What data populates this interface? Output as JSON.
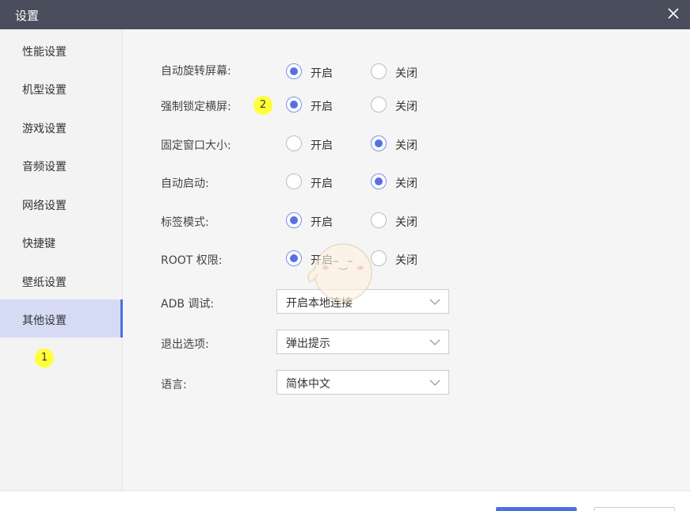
{
  "window": {
    "title": "设置",
    "close_icon": "close-icon"
  },
  "sidebar": {
    "items": [
      {
        "label": "性能设置",
        "active": false
      },
      {
        "label": "机型设置",
        "active": false
      },
      {
        "label": "游戏设置",
        "active": false
      },
      {
        "label": "音频设置",
        "active": false
      },
      {
        "label": "网络设置",
        "active": false
      },
      {
        "label": "快捷键",
        "active": false
      },
      {
        "label": "壁纸设置",
        "active": false
      },
      {
        "label": "其他设置",
        "active": true
      }
    ],
    "badge": "1"
  },
  "settings": {
    "badge": "2",
    "radio_rows": [
      {
        "label": "自动旋转屏幕:",
        "on_label": "开启",
        "off_label": "关闭",
        "selected": "on"
      },
      {
        "label": "强制锁定横屏:",
        "on_label": "开启",
        "off_label": "关闭",
        "selected": "on"
      },
      {
        "label": "固定窗口大小:",
        "on_label": "开启",
        "off_label": "关闭",
        "selected": "off"
      },
      {
        "label": "自动启动:",
        "on_label": "开启",
        "off_label": "关闭",
        "selected": "off"
      },
      {
        "label": "标签模式:",
        "on_label": "开启",
        "off_label": "关闭",
        "selected": "on"
      },
      {
        "label": "ROOT 权限:",
        "on_label": "开启",
        "off_label": "关闭",
        "selected": "on"
      }
    ],
    "selects": [
      {
        "label": "ADB 调试:",
        "value": "开启本地连接"
      },
      {
        "label": "退出选项:",
        "value": "弹出提示"
      },
      {
        "label": "语言:",
        "value": "简体中文"
      }
    ]
  },
  "colors": {
    "accent": "#5671e3",
    "titlebar": "#4a4d5c",
    "badge": "#ffff3a",
    "nav_active": "#d6dbf5"
  }
}
